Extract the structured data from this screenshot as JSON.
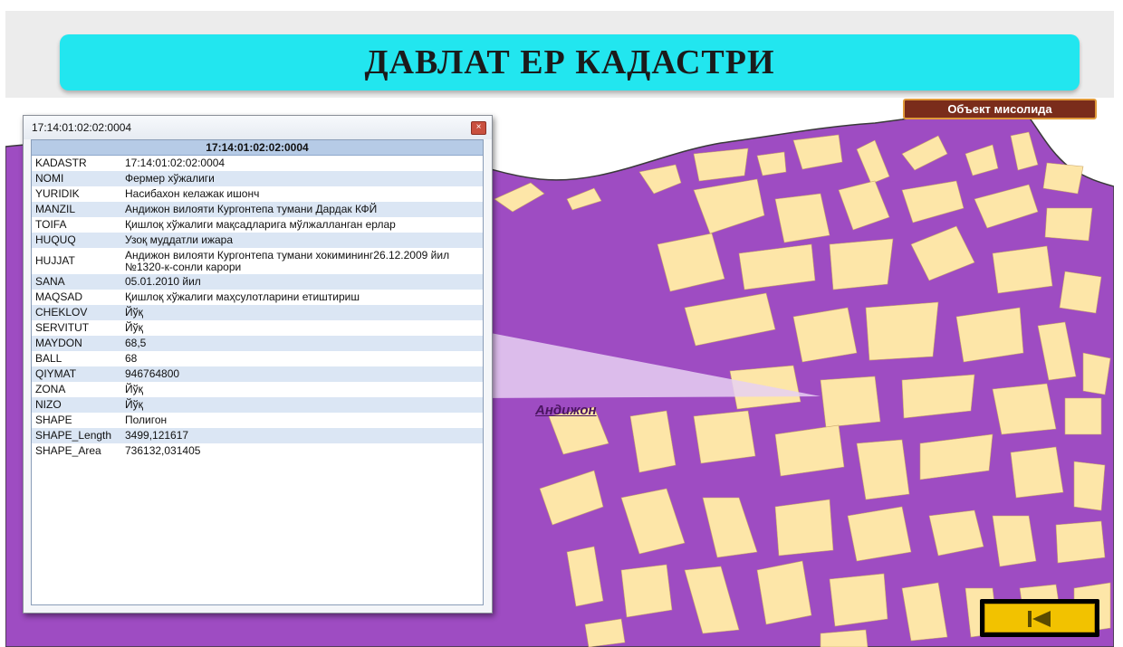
{
  "slide": {
    "title": "ДАВЛАТ ЕР КАДАСТРИ"
  },
  "map": {
    "object_button": "Объект мисолида",
    "city_label": "Андижон",
    "back_button_icon": "skip-back-icon",
    "colors": {
      "land": "#9e4cc2",
      "parcel": "#fde6a8",
      "accent": "#22e6ef"
    }
  },
  "dialog": {
    "title": "17:14:01:02:02:0004",
    "header": "17:14:01:02:02:0004",
    "rows": [
      {
        "key": "KADASTR",
        "value": "17:14:01:02:02:0004"
      },
      {
        "key": "NOMI",
        "value": "Фермер хўжалиги"
      },
      {
        "key": "YURIDIK",
        "value": "Насибахон келажак ишонч"
      },
      {
        "key": "MANZIL",
        "value": "Андижон вилояти Кургонтепа тумани Дардак КФЙ"
      },
      {
        "key": "TOIFA",
        "value": "Қишлоқ хўжалиги мақсадларига мўлжалланган ерлар"
      },
      {
        "key": "HUQUQ",
        "value": "Узоқ муддатли ижара"
      },
      {
        "key": "HUJJAT",
        "value": "Андижон вилояти Кургонтепа тумани хокимининг26.12.2009 йил №1320-к-сонли карори"
      },
      {
        "key": "SANA",
        "value": "05.01.2010 йил"
      },
      {
        "key": "MAQSAD",
        "value": "Қишлоқ хўжалиги маҳсулотларини етиштириш"
      },
      {
        "key": "CHEKLOV",
        "value": "Йўқ"
      },
      {
        "key": "SERVITUT",
        "value": "Йўқ"
      },
      {
        "key": "MAYDON",
        "value": "68,5"
      },
      {
        "key": "BALL",
        "value": "68"
      },
      {
        "key": "QIYMAT",
        "value": "946764800"
      },
      {
        "key": "ZONA",
        "value": "Йўқ"
      },
      {
        "key": "NIZO",
        "value": "Йўқ"
      },
      {
        "key": "SHAPE",
        "value": "Полигон"
      },
      {
        "key": "SHAPE_Length",
        "value": "3499,121617"
      },
      {
        "key": "SHAPE_Area",
        "value": "736132,031405"
      }
    ]
  }
}
